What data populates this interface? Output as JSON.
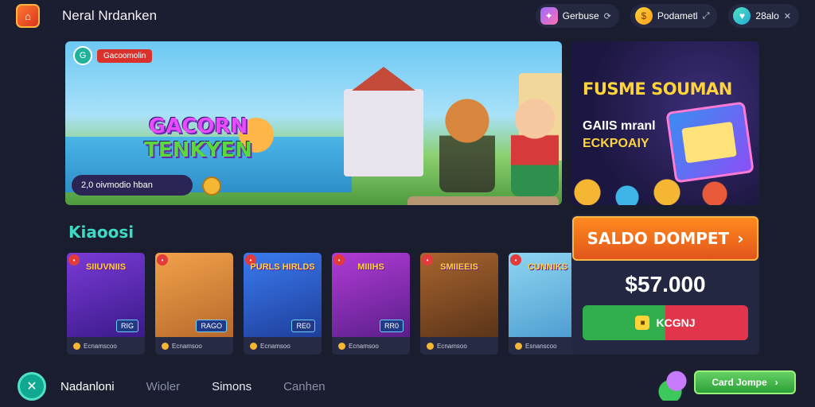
{
  "header": {
    "title": "Neral Nrdanken",
    "pill1": {
      "label": "Gerbuse",
      "icon": "gift-box-icon"
    },
    "pill2": {
      "label": "Podametl",
      "icon": "coin-icon"
    },
    "pill3": {
      "label": "28alo",
      "icon": "heart-gem-icon"
    }
  },
  "hero": {
    "badge_tag": "Gacoomolin",
    "logo_line1": "GACORN",
    "logo_line2": "TENKYEN",
    "strip": "2,0 oivmodio hban"
  },
  "promo": {
    "title": "FUSME SOUMAN",
    "sub_line1": "GAIIS mranl",
    "sub_line2": "ECKPOAIY"
  },
  "section": {
    "title": "Kiaoosi"
  },
  "games": [
    {
      "name": "SIIUVNIIS",
      "price": "RIG",
      "foot": "Ecnamscoo"
    },
    {
      "name": "",
      "price": "RAGO",
      "foot": "Ecnamsoo"
    },
    {
      "name": "PURLS HIRLDS",
      "price": "RE0",
      "foot": "Ecnamsoo"
    },
    {
      "name": "MIIIHS",
      "price": "RR0",
      "foot": "Ecnamsoo"
    },
    {
      "name": "SMIIEEIS",
      "price": "",
      "foot": "Ecnamsoo"
    },
    {
      "name": "CUNNIKS",
      "price": "",
      "foot": "Esnanscoo"
    }
  ],
  "wallet": {
    "button_label": "SALDO DOMPET",
    "amount": "$57.000",
    "action_label": "KCGNJ"
  },
  "bottom": {
    "items": [
      "Nadanloni",
      "Wioler",
      "Simons",
      "Canhen"
    ],
    "cta_label": "Card Jompe"
  }
}
